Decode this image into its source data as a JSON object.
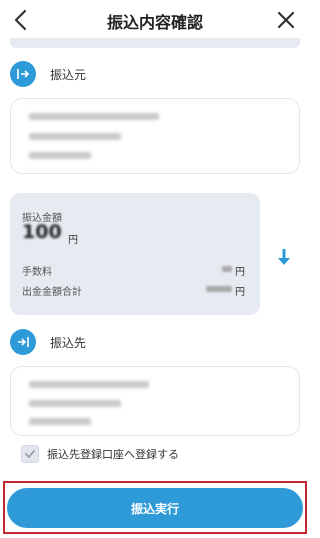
{
  "header": {
    "title": "振込内容確認"
  },
  "from_section": {
    "label": "振込元"
  },
  "amount": {
    "transfer_amount_label": "振込金額",
    "transfer_amount_value": "100",
    "transfer_amount_unit": "円",
    "fee_label": "手数料",
    "fee_unit": "円",
    "total_label": "出金金額合計",
    "total_unit": "円"
  },
  "to_section": {
    "label": "振込先"
  },
  "register_checkbox": {
    "label": "振込先登録口座へ登録する",
    "checked": true
  },
  "execute_button": {
    "label": "振込実行"
  },
  "colors": {
    "accent": "#2f9ad8",
    "highlight_frame": "#c0282e",
    "card_bg": "#e6ebf1"
  },
  "icons": {
    "back": "chevron-left-icon",
    "close": "close-icon",
    "from": "arrow-out-icon",
    "to": "arrow-in-icon",
    "arrow_down": "arrow-down-icon",
    "check": "check-icon"
  }
}
